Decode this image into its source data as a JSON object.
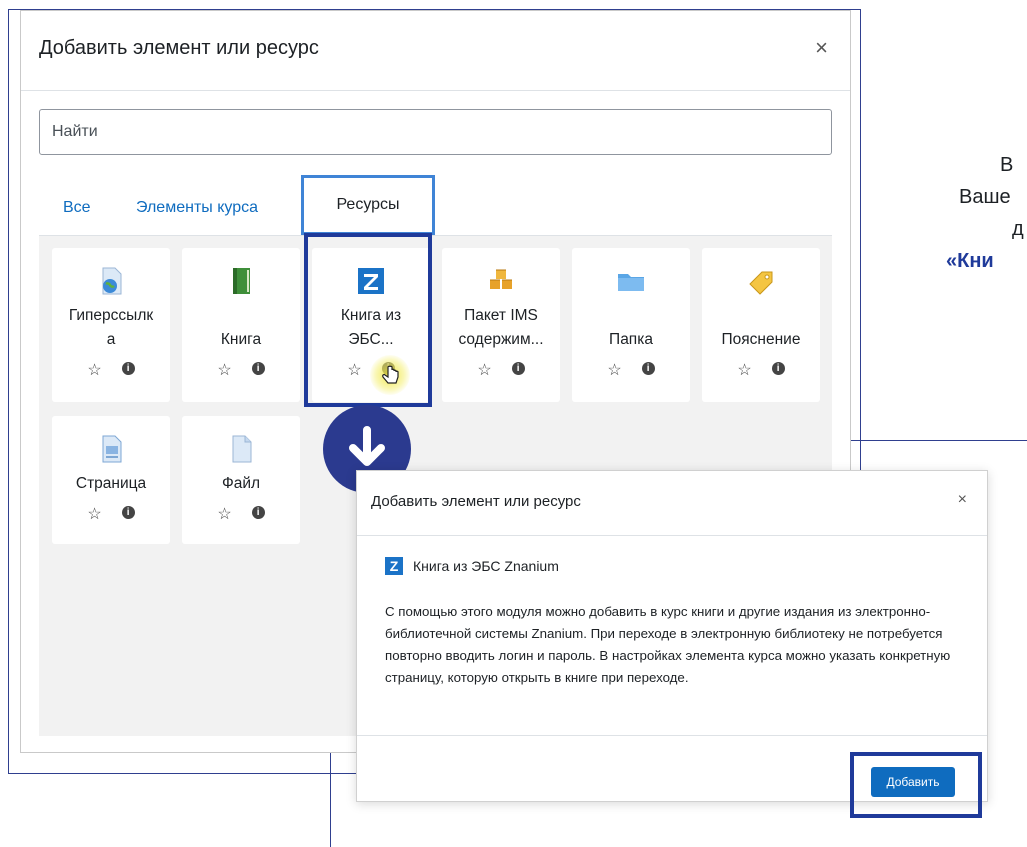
{
  "modal1": {
    "title": "Добавить элемент или ресурс",
    "close": "×",
    "search_placeholder": "Найти",
    "tabs": [
      "Все",
      "Элементы курса",
      "Ресурсы"
    ],
    "tiles_row1": [
      {
        "line1": "Гиперссылк",
        "line2": "а",
        "icon": "url-globe-icon"
      },
      {
        "line1": "Книга",
        "line2": "",
        "icon": "book-icon"
      },
      {
        "line1": "Книга из",
        "line2": "ЭБС...",
        "icon": "znanium-z-icon"
      },
      {
        "line1": "Пакет IMS",
        "line2": "содержим...",
        "icon": "package-icon"
      },
      {
        "line1": "Папка",
        "line2": "",
        "icon": "folder-icon"
      },
      {
        "line1": "Пояснение",
        "line2": "",
        "icon": "label-tag-icon"
      }
    ],
    "tiles_row2": [
      {
        "line1": "Страница",
        "icon": "page-icon"
      },
      {
        "line1": "Файл",
        "icon": "file-icon"
      }
    ],
    "star": "☆",
    "info": "i"
  },
  "side_text": {
    "line1": "В",
    "line2": "Ваше",
    "line3": "д",
    "line4": "«Кни"
  },
  "modal2": {
    "title": "Добавить элемент или ресурс",
    "close": "×",
    "module_logo": "Z",
    "module_name": "Книга из ЭБС Znanium",
    "description": "С помощью этого модуля можно добавить в курс книги и другие издания из электронно-библиотечной системы Znanium. При переходе в электронную библиотеку не потребуется повторно вводить логин и пароль. В настройках элемента курса можно указать конкретную страницу, которую открыть в книге при переходе.",
    "add_button": "Добавить"
  },
  "colors": {
    "accent": "#0f6cbf",
    "highlight": "#1f3a9a",
    "znanium": "#1b73c7"
  }
}
